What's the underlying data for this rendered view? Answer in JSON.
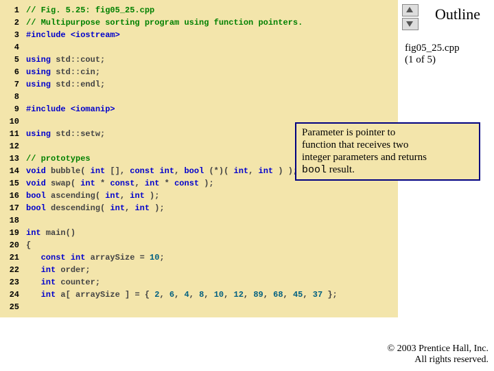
{
  "outline": {
    "title": "Outline",
    "file": "fig05_25.cpp",
    "part": "(1 of 5)"
  },
  "callout": {
    "line1": "Parameter is pointer to",
    "line2": "function that receives two",
    "line3": "integer parameters and returns",
    "code": "bool",
    "line4": " result."
  },
  "footer": {
    "line1": "© 2003 Prentice Hall, Inc.",
    "line2": "All rights reserved."
  },
  "code": [
    {
      "n": "1",
      "seg": [
        {
          "c": "c-comment bold",
          "t": "// Fig. 5.25: fig05_25.cpp"
        }
      ]
    },
    {
      "n": "2",
      "seg": [
        {
          "c": "c-comment bold",
          "t": "// Multipurpose sorting program using function pointers."
        }
      ]
    },
    {
      "n": "3",
      "seg": [
        {
          "c": "c-pre bold",
          "t": "#include "
        },
        {
          "c": "c-pre bold",
          "t": "<iostream>"
        }
      ]
    },
    {
      "n": "4",
      "seg": []
    },
    {
      "n": "5",
      "seg": [
        {
          "c": "c-kw bold",
          "t": "using "
        },
        {
          "c": "bold",
          "t": "std::cout;"
        }
      ]
    },
    {
      "n": "6",
      "seg": [
        {
          "c": "c-kw bold",
          "t": "using "
        },
        {
          "c": "bold",
          "t": "std::cin;"
        }
      ]
    },
    {
      "n": "7",
      "seg": [
        {
          "c": "c-kw bold",
          "t": "using "
        },
        {
          "c": "bold",
          "t": "std::endl;"
        }
      ]
    },
    {
      "n": "8",
      "seg": []
    },
    {
      "n": "9",
      "seg": [
        {
          "c": "c-pre bold",
          "t": "#include "
        },
        {
          "c": "c-pre bold",
          "t": "<iomanip>"
        }
      ]
    },
    {
      "n": "10",
      "seg": []
    },
    {
      "n": "11",
      "seg": [
        {
          "c": "c-kw bold",
          "t": "using "
        },
        {
          "c": "bold",
          "t": "std::setw;"
        }
      ]
    },
    {
      "n": "12",
      "seg": []
    },
    {
      "n": "13",
      "seg": [
        {
          "c": "c-comment bold",
          "t": "// prototypes"
        }
      ]
    },
    {
      "n": "14",
      "seg": [
        {
          "c": "c-kw bold",
          "t": "void"
        },
        {
          "c": "bold",
          "t": " bubble( "
        },
        {
          "c": "c-kw bold",
          "t": "int"
        },
        {
          "c": "bold",
          "t": " [], "
        },
        {
          "c": "c-kw bold",
          "t": "const int"
        },
        {
          "c": "bold",
          "t": ", "
        },
        {
          "c": "c-kw bold",
          "t": "bool"
        },
        {
          "c": "bold",
          "t": " (*)( "
        },
        {
          "c": "c-kw bold",
          "t": "int"
        },
        {
          "c": "bold",
          "t": ", "
        },
        {
          "c": "c-kw bold",
          "t": "int"
        },
        {
          "c": "bold",
          "t": " ) );"
        }
      ]
    },
    {
      "n": "15",
      "seg": [
        {
          "c": "c-kw bold",
          "t": "void"
        },
        {
          "c": "bold",
          "t": " swap( "
        },
        {
          "c": "c-kw bold",
          "t": "int"
        },
        {
          "c": "bold",
          "t": " * "
        },
        {
          "c": "c-kw bold",
          "t": "const"
        },
        {
          "c": "bold",
          "t": ", "
        },
        {
          "c": "c-kw bold",
          "t": "int"
        },
        {
          "c": "bold",
          "t": " * "
        },
        {
          "c": "c-kw bold",
          "t": "const"
        },
        {
          "c": "bold",
          "t": " );"
        }
      ]
    },
    {
      "n": "16",
      "seg": [
        {
          "c": "c-kw bold",
          "t": "bool"
        },
        {
          "c": "bold",
          "t": " ascending( "
        },
        {
          "c": "c-kw bold",
          "t": "int"
        },
        {
          "c": "bold",
          "t": ", "
        },
        {
          "c": "c-kw bold",
          "t": "int"
        },
        {
          "c": "bold",
          "t": " );"
        }
      ]
    },
    {
      "n": "17",
      "seg": [
        {
          "c": "c-kw bold",
          "t": "bool"
        },
        {
          "c": "bold",
          "t": " descending( "
        },
        {
          "c": "c-kw bold",
          "t": "int"
        },
        {
          "c": "bold",
          "t": ", "
        },
        {
          "c": "c-kw bold",
          "t": "int"
        },
        {
          "c": "bold",
          "t": " );"
        }
      ]
    },
    {
      "n": "18",
      "seg": []
    },
    {
      "n": "19",
      "seg": [
        {
          "c": "c-kw bold",
          "t": "int"
        },
        {
          "c": "bold",
          "t": " main()"
        }
      ]
    },
    {
      "n": "20",
      "seg": [
        {
          "c": "bold",
          "t": "{"
        }
      ]
    },
    {
      "n": "21",
      "seg": [
        {
          "c": "bold",
          "t": "   "
        },
        {
          "c": "c-kw bold",
          "t": "const int"
        },
        {
          "c": "bold",
          "t": " arraySize = "
        },
        {
          "c": "c-num bold",
          "t": "10"
        },
        {
          "c": "bold",
          "t": ";"
        }
      ]
    },
    {
      "n": "22",
      "seg": [
        {
          "c": "bold",
          "t": "   "
        },
        {
          "c": "c-kw bold",
          "t": "int"
        },
        {
          "c": "bold",
          "t": " order;"
        }
      ]
    },
    {
      "n": "23",
      "seg": [
        {
          "c": "bold",
          "t": "   "
        },
        {
          "c": "c-kw bold",
          "t": "int"
        },
        {
          "c": "bold",
          "t": " counter;"
        }
      ]
    },
    {
      "n": "24",
      "seg": [
        {
          "c": "bold",
          "t": "   "
        },
        {
          "c": "c-kw bold",
          "t": "int"
        },
        {
          "c": "bold",
          "t": " a[ arraySize ] = { "
        },
        {
          "c": "c-num bold",
          "t": "2"
        },
        {
          "c": "bold",
          "t": ", "
        },
        {
          "c": "c-num bold",
          "t": "6"
        },
        {
          "c": "bold",
          "t": ", "
        },
        {
          "c": "c-num bold",
          "t": "4"
        },
        {
          "c": "bold",
          "t": ", "
        },
        {
          "c": "c-num bold",
          "t": "8"
        },
        {
          "c": "bold",
          "t": ", "
        },
        {
          "c": "c-num bold",
          "t": "10"
        },
        {
          "c": "bold",
          "t": ", "
        },
        {
          "c": "c-num bold",
          "t": "12"
        },
        {
          "c": "bold",
          "t": ", "
        },
        {
          "c": "c-num bold",
          "t": "89"
        },
        {
          "c": "bold",
          "t": ", "
        },
        {
          "c": "c-num bold",
          "t": "68"
        },
        {
          "c": "bold",
          "t": ", "
        },
        {
          "c": "c-num bold",
          "t": "45"
        },
        {
          "c": "bold",
          "t": ", "
        },
        {
          "c": "c-num bold",
          "t": "37"
        },
        {
          "c": "bold",
          "t": " };"
        }
      ]
    },
    {
      "n": "25",
      "seg": []
    }
  ]
}
